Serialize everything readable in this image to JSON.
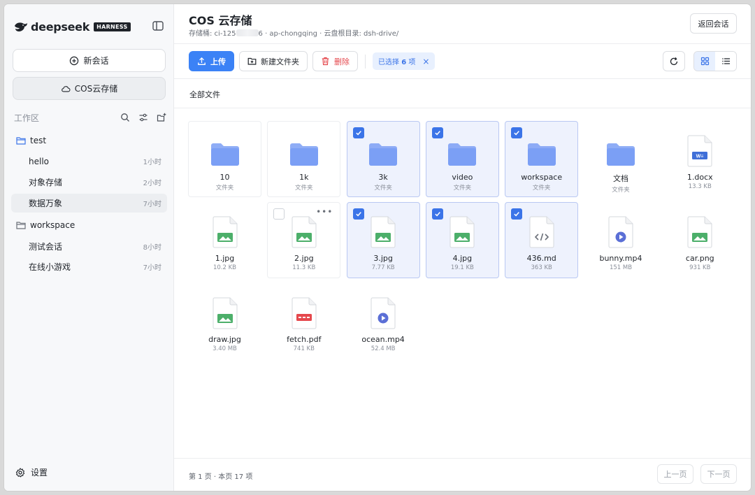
{
  "brand": {
    "name": "deepseek",
    "tag": "HARNESS"
  },
  "sidebar": {
    "new_chat": "新会话",
    "cos": "COS云存储",
    "workspace_title": "工作区",
    "groups": [
      {
        "name": "test",
        "items": [
          {
            "label": "hello",
            "time": "1小时"
          },
          {
            "label": "对象存储",
            "time": "2小时"
          },
          {
            "label": "数据万象",
            "time": "7小时",
            "active": true
          }
        ]
      },
      {
        "name": "workspace",
        "items": [
          {
            "label": "测试会话",
            "time": "8小时"
          },
          {
            "label": "在线小游戏",
            "time": "7小时"
          }
        ]
      }
    ],
    "settings": "设置"
  },
  "header": {
    "title": "COS 云存储",
    "subtitle_prefix": "存储桶: ci-125",
    "subtitle_suffix": "6 · ap-chongqing · 云盘根目录: dsh-drive/",
    "back": "返回会话"
  },
  "toolbar": {
    "upload": "上传",
    "new_folder": "新建文件夹",
    "delete": "删除",
    "selected_prefix": "已选择 ",
    "selected_count": "6",
    "selected_suffix": " 项"
  },
  "breadcrumb": "全部文件",
  "files": [
    {
      "name": "10",
      "meta": "文件夹",
      "type": "folder",
      "state": "plain"
    },
    {
      "name": "1k",
      "meta": "文件夹",
      "type": "folder",
      "state": "plain"
    },
    {
      "name": "3k",
      "meta": "文件夹",
      "type": "folder",
      "state": "selected"
    },
    {
      "name": "video",
      "meta": "文件夹",
      "type": "folder",
      "state": "selected"
    },
    {
      "name": "workspace",
      "meta": "文件夹",
      "type": "folder",
      "state": "selected"
    },
    {
      "name": "文档",
      "meta": "文件夹",
      "type": "folder",
      "state": "none"
    },
    {
      "name": "1.docx",
      "meta": "13.3 KB",
      "type": "word",
      "state": "none"
    },
    {
      "name": "1.jpg",
      "meta": "10.2 KB",
      "type": "image",
      "state": "none"
    },
    {
      "name": "2.jpg",
      "meta": "11.3 KB",
      "type": "image",
      "state": "hover"
    },
    {
      "name": "3.jpg",
      "meta": "7.77 KB",
      "type": "image",
      "state": "selected"
    },
    {
      "name": "4.jpg",
      "meta": "19.1 KB",
      "type": "image",
      "state": "selected"
    },
    {
      "name": "436.md",
      "meta": "363 KB",
      "type": "code",
      "state": "selected"
    },
    {
      "name": "bunny.mp4",
      "meta": "151 MB",
      "type": "video",
      "state": "none"
    },
    {
      "name": "car.png",
      "meta": "931 KB",
      "type": "image",
      "state": "none"
    },
    {
      "name": "draw.jpg",
      "meta": "3.40 MB",
      "type": "image",
      "state": "none"
    },
    {
      "name": "fetch.pdf",
      "meta": "741 KB",
      "type": "pdf",
      "state": "none"
    },
    {
      "name": "ocean.mp4",
      "meta": "52.4 MB",
      "type": "video",
      "state": "none"
    }
  ],
  "footer": {
    "info": "第 1 页 · 本页 17 项",
    "prev": "上一页",
    "next": "下一页"
  },
  "colors": {
    "accent": "#3b82f6",
    "folder": "#7b9ff5",
    "image": "#4caf6a",
    "word": "#3f6fd8",
    "pdf": "#e5484d",
    "video": "#5b6fd6",
    "danger": "#e5484d"
  }
}
